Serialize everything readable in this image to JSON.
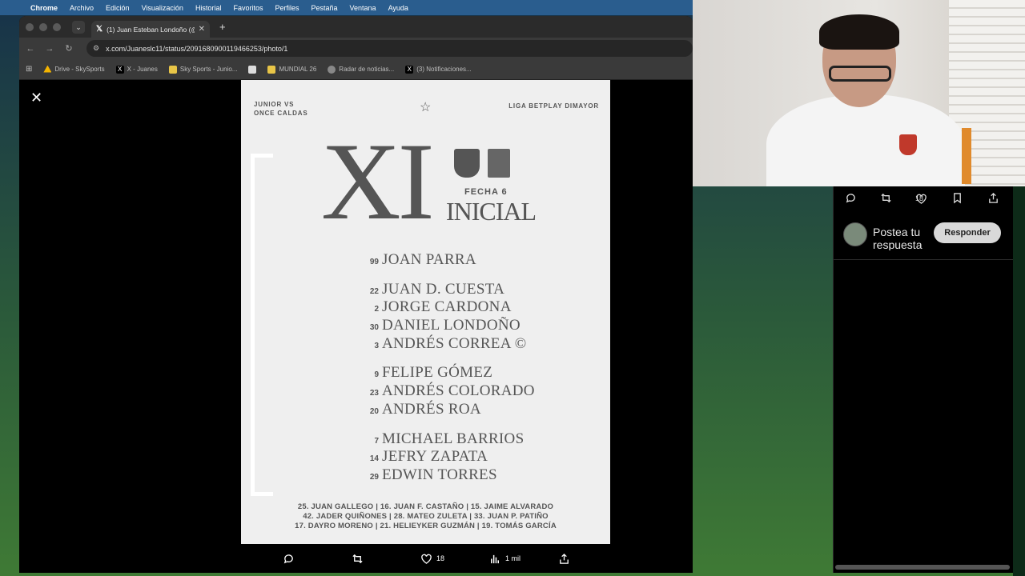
{
  "menubar": {
    "items": [
      "Chrome",
      "Archivo",
      "Edición",
      "Visualización",
      "Historial",
      "Favoritos",
      "Perfiles",
      "Pestaña",
      "Ventana",
      "Ayuda"
    ]
  },
  "browser": {
    "tab_title": "(1) Juan Esteban Londoño (@",
    "url": "x.com/Juaneslc11/status/2091680900119466253/photo/1",
    "bookmarks": [
      {
        "label": "Drive - SkySports",
        "icon": "drive-icon",
        "color": "#f4b400"
      },
      {
        "label": "X - Juanes",
        "icon": "x-icon",
        "color": "#000000"
      },
      {
        "label": "Sky Sports - Junio...",
        "icon": "folder-icon",
        "color": "#e8c547"
      },
      {
        "label": "",
        "icon": "page-icon",
        "color": "#bbbbbb"
      },
      {
        "label": "MUNDIAL 26",
        "icon": "mundial-icon",
        "color": "#e8c547"
      },
      {
        "label": "Radar de noticias...",
        "icon": "globe-icon",
        "color": "#888888"
      },
      {
        "label": "(3) Notificaciones...",
        "icon": "x-icon",
        "color": "#000000"
      }
    ]
  },
  "poster": {
    "match_line1": "JUNIOR VS",
    "match_line2": "ONCE CALDAS",
    "league": "LIGA BETPLAY DIMAYOR",
    "big_title": "XI",
    "fecha": "FECHA 6",
    "inicial": "INICIAL",
    "lineup_groups": [
      [
        {
          "num": "99",
          "name": "JOAN PARRA"
        }
      ],
      [
        {
          "num": "22",
          "name": "JUAN D. CUESTA"
        },
        {
          "num": "2",
          "name": "JORGE CARDONA"
        },
        {
          "num": "30",
          "name": "DANIEL LONDOÑO"
        },
        {
          "num": "3",
          "name": "ANDRÉS CORREA ©"
        }
      ],
      [
        {
          "num": "9",
          "name": "FELIPE GÓMEZ"
        },
        {
          "num": "23",
          "name": "ANDRÉS COLORADO"
        },
        {
          "num": "20",
          "name": "ANDRÉS ROA"
        }
      ],
      [
        {
          "num": "7",
          "name": "MICHAEL BARRIOS"
        },
        {
          "num": "14",
          "name": "JEFRY ZAPATA"
        },
        {
          "num": "29",
          "name": "EDWIN TORRES"
        }
      ]
    ],
    "subs": [
      "25. JUAN GALLEGO  |  16. JUAN F. CASTAÑO  |  15. JAIME ALVARADO",
      "42. JADER QUIÑONES | 28. MATEO ZULETA  |  33. JUAN P. PATIÑO",
      "17. DAYRO MORENO  |  21. HELIEYKER GUZMÁN  |  19. TOMÁS GARCÍA"
    ]
  },
  "media_actions": {
    "likes": "18",
    "views": "1 mil"
  },
  "reply_panel": {
    "likes": "18",
    "placeholder": "Postea tu respuesta",
    "reply_button": "Responder"
  }
}
